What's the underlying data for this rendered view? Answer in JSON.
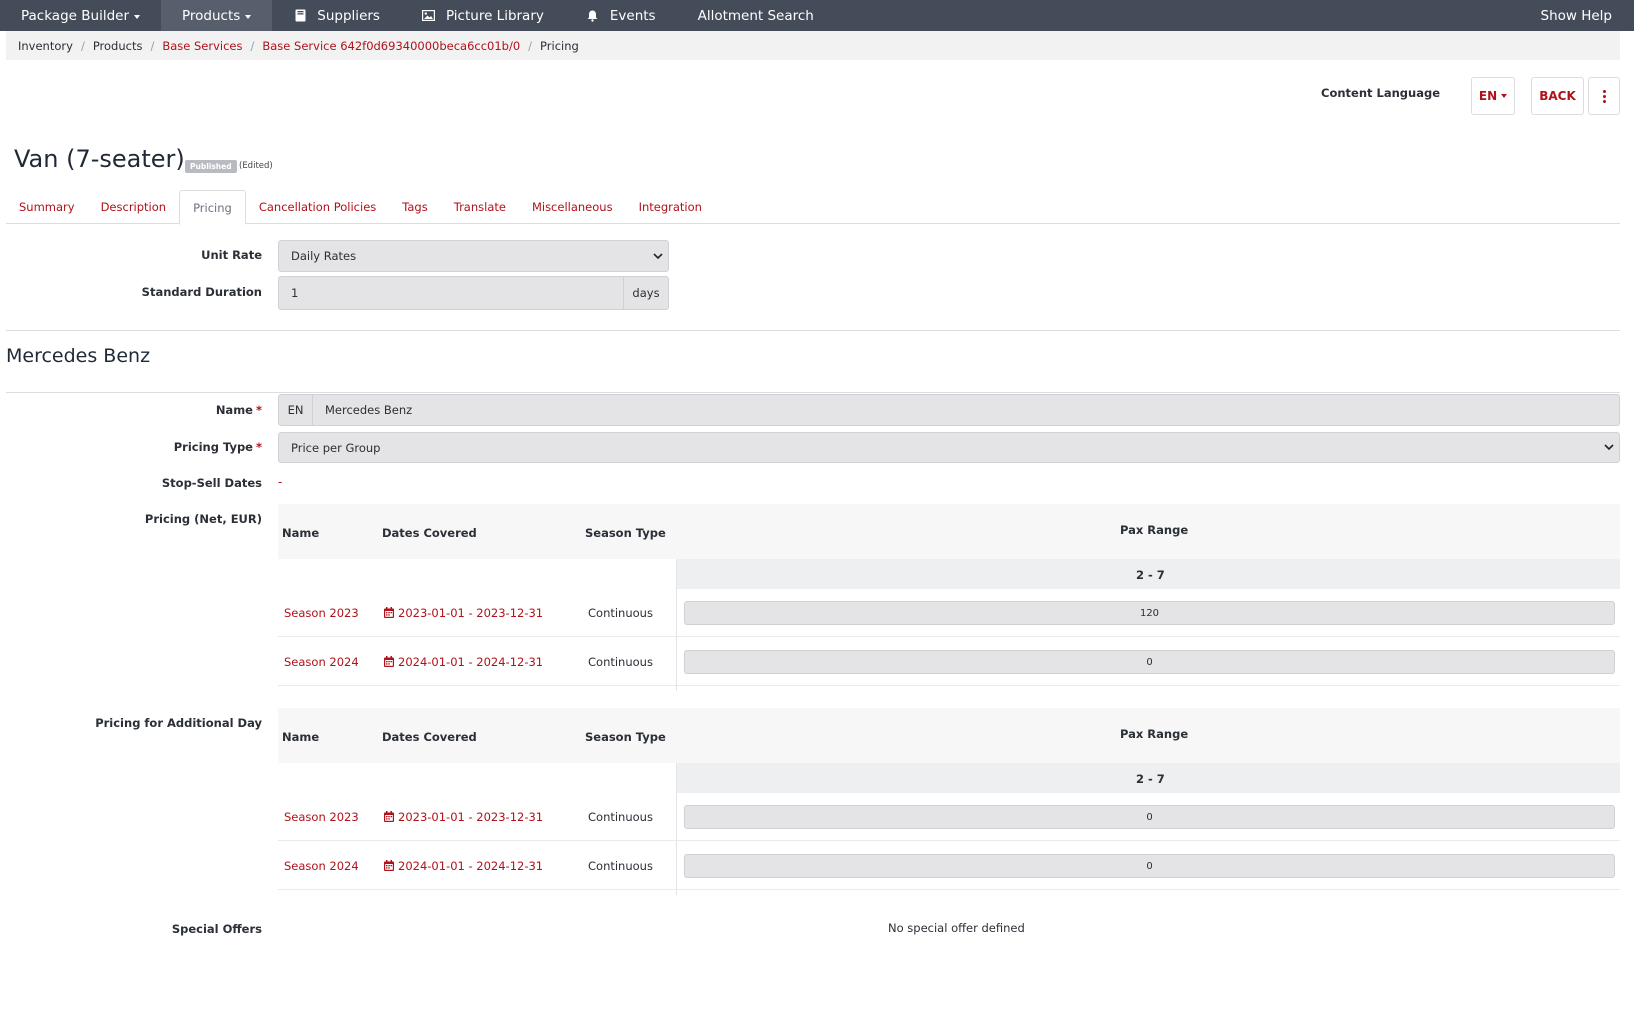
{
  "nav": {
    "package_builder": "Package Builder",
    "products": "Products",
    "suppliers": "Suppliers",
    "picture_library": "Picture Library",
    "events": "Events",
    "allotment_search": "Allotment Search",
    "show_help": "Show Help"
  },
  "breadcrumb": [
    "Inventory",
    "Products",
    "Base Services",
    "Base Service 642f0d69340000beca6cc01b/0",
    "Pricing"
  ],
  "header": {
    "content_language_label": "Content Language",
    "lang_value": "EN",
    "back_label": "BACK"
  },
  "title": {
    "text": "Van (7-seater)",
    "badge": "Published",
    "edited": "(Edited)"
  },
  "tabs": [
    "Summary",
    "Description",
    "Pricing",
    "Cancellation Policies",
    "Tags",
    "Translate",
    "Miscellaneous",
    "Integration"
  ],
  "form": {
    "unit_rate_label": "Unit Rate",
    "unit_rate_value": "Daily Rates",
    "standard_duration_label": "Standard Duration",
    "standard_duration_value": "1",
    "standard_duration_unit": "days"
  },
  "section": {
    "title": "Mercedes Benz",
    "name_label": "Name",
    "name_lang": "EN",
    "name_value": "Mercedes Benz",
    "pricing_type_label": "Pricing Type",
    "pricing_type_value": "Price per Group",
    "required_mark": "*",
    "stop_sell_label": "Stop-Sell Dates",
    "stop_sell_value": "-",
    "pricing_label": "Pricing (Net, EUR)",
    "additional_label": "Pricing for Additional Day",
    "special_offers_label": "Special Offers",
    "special_offers_value": "No special offer defined"
  },
  "table_headers": {
    "name": "Name",
    "dates": "Dates Covered",
    "season_type": "Season Type",
    "pax_range": "Pax Range",
    "pax_value": "2 - 7"
  },
  "pricing_rows": [
    {
      "name": "Season 2023",
      "dates": "2023-01-01 - 2023-12-31",
      "type": "Continuous",
      "price": "120"
    },
    {
      "name": "Season 2024",
      "dates": "2024-01-01 - 2024-12-31",
      "type": "Continuous",
      "price": "0"
    }
  ],
  "additional_rows": [
    {
      "name": "Season 2023",
      "dates": "2023-01-01 - 2023-12-31",
      "type": "Continuous",
      "price": "0"
    },
    {
      "name": "Season 2024",
      "dates": "2024-01-01 - 2024-12-31",
      "type": "Continuous",
      "price": "0"
    }
  ],
  "colors": {
    "nav_bg": "#444c59",
    "accent": "#b0121b",
    "field_bg": "#e4e4e6"
  }
}
